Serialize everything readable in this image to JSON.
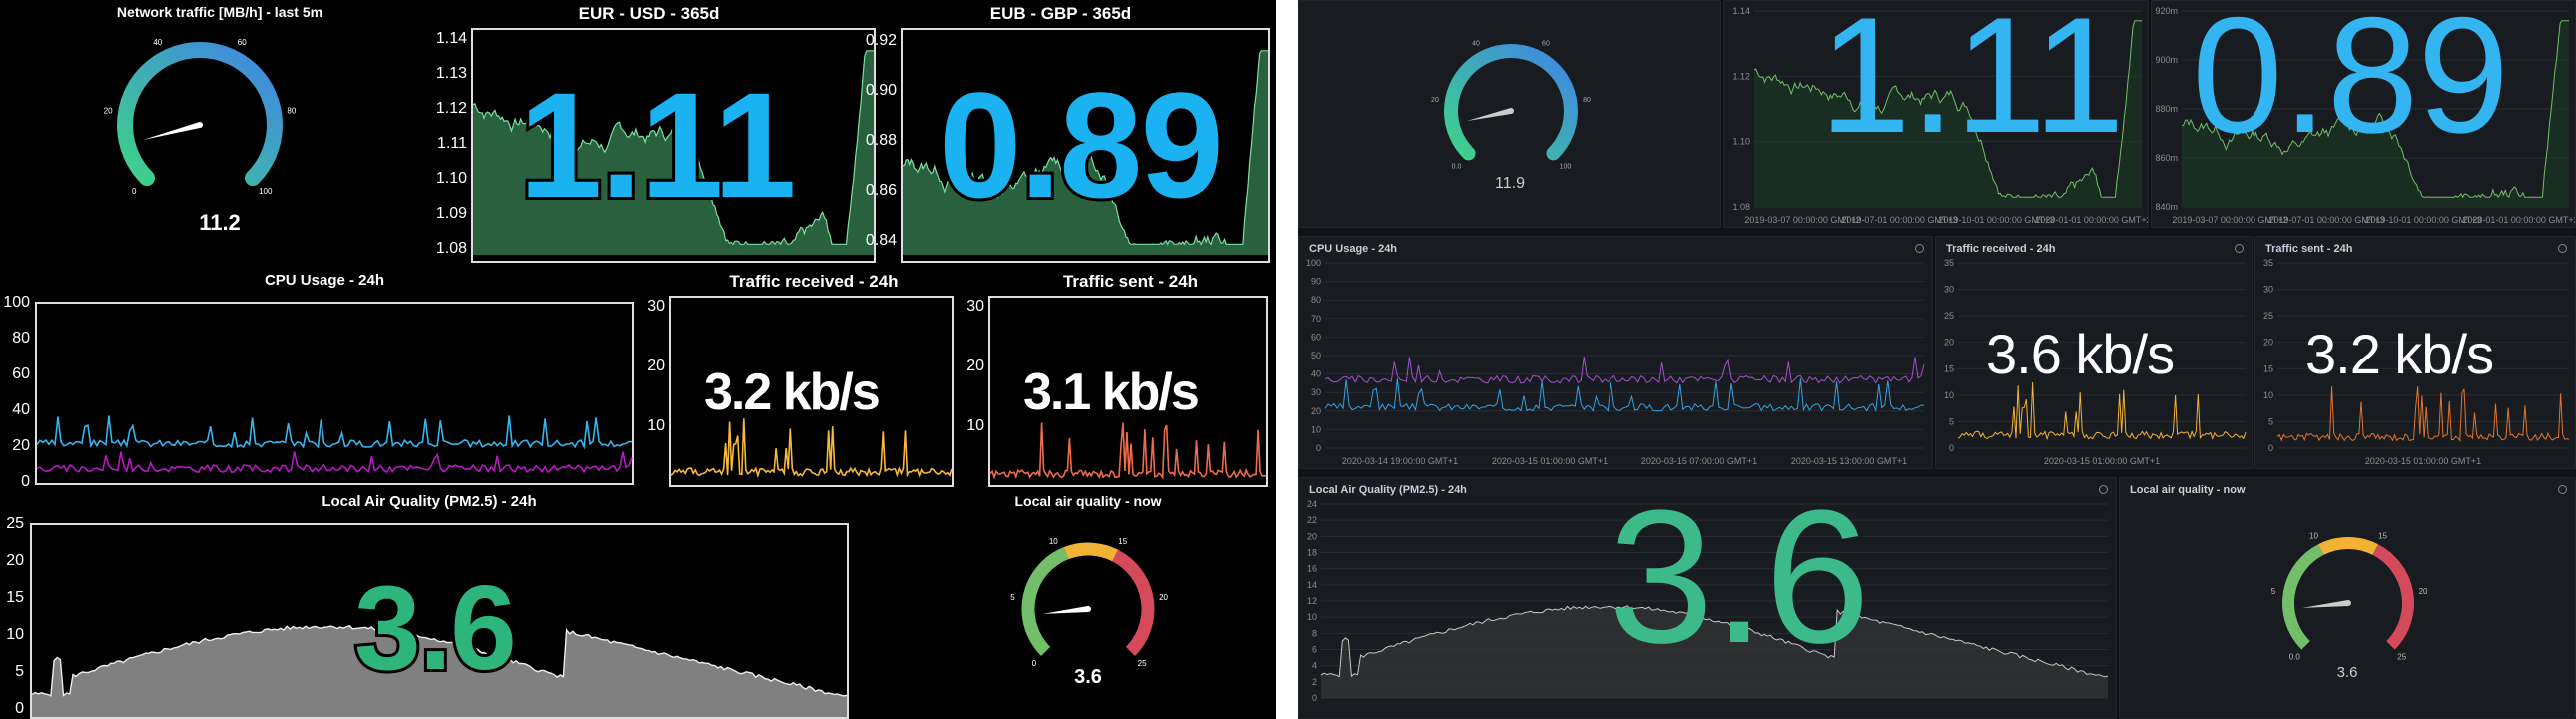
{
  "left": {
    "network": {
      "title": "Network traffic [MB/h] - last 5m",
      "value": "11.2",
      "value_num": 11.2,
      "min": 0,
      "max": 100,
      "ticks": [
        "0",
        "20",
        "40",
        "60",
        "80",
        "100"
      ],
      "color_low": "#3fd28a",
      "color_high": "#3f84e6"
    },
    "eurusd": {
      "title": "EUR - USD - 365d",
      "value": "1.11",
      "yticks": [
        "1.14",
        "1.13",
        "1.12",
        "1.11",
        "1.10",
        "1.09",
        "1.08"
      ],
      "color": "#6ccf8e",
      "value_color": "#1ab2f0"
    },
    "eurgbp": {
      "title": "EUB - GBP - 365d",
      "value": "0.89",
      "yticks": [
        "0.92",
        "0.90",
        "0.88",
        "0.86",
        "0.84"
      ],
      "color": "#6ccf8e",
      "value_color": "#1ab2f0"
    },
    "cpu": {
      "title": "CPU Usage - 24h",
      "yticks": [
        "100",
        "80",
        "60",
        "40",
        "20",
        "0"
      ],
      "color_a": "#35b6f0",
      "color_b": "#b819c5"
    },
    "recv": {
      "title": "Traffic received - 24h",
      "value": "3.2 kb/s",
      "yticks": [
        "30",
        "20",
        "10"
      ],
      "color": "#f6b93c"
    },
    "sent": {
      "title": "Traffic sent - 24h",
      "value": "3.1 kb/s",
      "yticks": [
        "30",
        "20",
        "10"
      ],
      "color": "#f06b4b"
    },
    "air": {
      "title": "Local Air Quality (PM2.5) - 24h",
      "value": "3.6",
      "yticks": [
        "25",
        "20",
        "15",
        "10",
        "5",
        "0"
      ],
      "value_color": "#2db57c"
    },
    "airnow": {
      "title": "Local air quality - now",
      "value": "3.6",
      "value_num": 3.6,
      "min": 0,
      "max": 25,
      "ticks": [
        "0",
        "5",
        "10",
        "15",
        "20",
        "25"
      ]
    }
  },
  "right": {
    "network": {
      "value": "11.9",
      "value_num": 11.9,
      "min": 0,
      "max": 100,
      "ticks": [
        "0.0",
        "20",
        "40",
        "60",
        "80",
        "100"
      ]
    },
    "eurusd": {
      "value": "1.11",
      "yticks": [
        "1.14",
        "1.12",
        "1.10",
        "1.08"
      ],
      "xticks": [
        "2019-03-07 00:00:00 GMT+2",
        "2019-07-01 00:00:00 GMT+3",
        "2019-10-01 00:00:00 GMT+3",
        "2020-01-01 00:00:00 GMT+2"
      ]
    },
    "eurgbp": {
      "value": "0.89",
      "yticks": [
        "920m",
        "900m",
        "880m",
        "860m",
        "840m"
      ],
      "xticks": [
        "2019-03-07 00:00:00 GMT+2",
        "2019-07-01 00:00:00 GMT+3",
        "2019-10-01 00:00:00 GMT+3",
        "2020-01-01 00:00:00 GMT+2"
      ]
    },
    "cpu": {
      "title": "CPU Usage - 24h",
      "yticks": [
        "100",
        "90",
        "80",
        "70",
        "60",
        "50",
        "40",
        "30",
        "20",
        "10",
        "0"
      ],
      "xticks": [
        "2020-03-14 19:00:00 GMT+1",
        "2020-03-15 01:00:00 GMT+1",
        "2020-03-15 07:00:00 GMT+1",
        "2020-03-15 13:00:00 GMT+1"
      ]
    },
    "recv": {
      "title": "Traffic received - 24h",
      "value": "3.6 kb/s",
      "yticks": [
        "35",
        "30",
        "25",
        "20",
        "15",
        "10",
        "5",
        "0"
      ],
      "xticks": [
        "2020-03-15 01:00:00 GMT+1"
      ]
    },
    "sent": {
      "title": "Traffic sent - 24h",
      "value": "3.2 kb/s",
      "yticks": [
        "35",
        "30",
        "25",
        "20",
        "15",
        "10",
        "5",
        "0"
      ],
      "xticks": [
        "2020-03-15 01:00:00 GMT+1"
      ]
    },
    "air": {
      "title": "Local Air Quality (PM2.5) - 24h",
      "value": "3.6",
      "yticks": [
        "24",
        "22",
        "20",
        "18",
        "16",
        "14",
        "12",
        "10",
        "8",
        "6",
        "4",
        "2",
        "0"
      ]
    },
    "airnow": {
      "title": "Local air quality - now",
      "value": "3.6",
      "value_num": 3.6,
      "min": 0,
      "max": 25,
      "ticks": [
        "0.0",
        "5",
        "10",
        "15",
        "20",
        "25"
      ]
    }
  }
}
